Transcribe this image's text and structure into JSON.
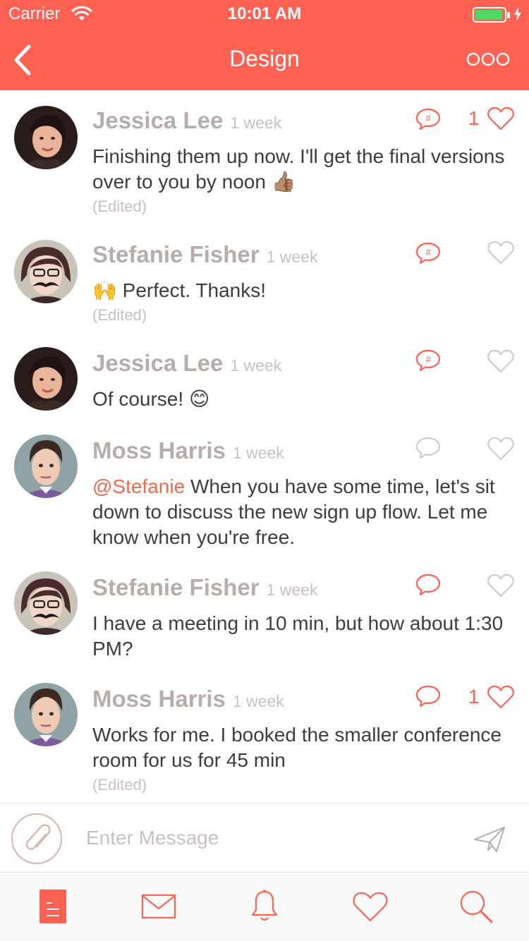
{
  "status_bar": {
    "carrier": "Carrier",
    "time": "10:01 AM"
  },
  "nav": {
    "title": "Design",
    "back_icon": "chevron-left-icon",
    "more_icon": "more-dots-icon"
  },
  "colors": {
    "accent": "#ff6152",
    "mention": "#ef6b4f",
    "name": "#b7aeab",
    "meta": "#c9c1be",
    "text": "#3d3d3d"
  },
  "messages": [
    {
      "author": "Jessica Lee",
      "time": "1 week",
      "text": "Finishing them up now. I'll get the final versions over to you by noon 👍🏽",
      "edited": "(Edited)",
      "like_count": "1",
      "liked": true,
      "comment_style": "tagged"
    },
    {
      "author": "Stefanie Fisher",
      "time": "1 week",
      "text": "🙌  Perfect. Thanks!",
      "edited": "(Edited)",
      "like_count": "",
      "liked": false,
      "comment_style": "tagged"
    },
    {
      "author": "Jessica Lee",
      "time": "1 week",
      "text": "Of course! 😊",
      "edited": "",
      "like_count": "",
      "liked": false,
      "comment_style": "tagged"
    },
    {
      "author": "Moss Harris",
      "time": "1 week",
      "mention": "@Stefanie",
      "text": " When you have some time, let's sit down to discuss the new sign up flow. Let me know when you're free.",
      "edited": "",
      "like_count": "",
      "liked": false,
      "comment_style": "empty"
    },
    {
      "author": "Stefanie Fisher",
      "time": "1 week",
      "text": "I have a meeting in 10 min, but how about 1:30 PM?",
      "edited": "",
      "like_count": "",
      "liked": false,
      "comment_style": "active"
    },
    {
      "author": "Moss Harris",
      "time": "1 week",
      "text": "Works for me. I booked the smaller conference room for us for 45 min",
      "edited": "(Edited)",
      "like_count": "1",
      "liked": true,
      "comment_style": "active"
    }
  ],
  "composer": {
    "placeholder": "Enter Message",
    "attach_icon": "paperclip-icon",
    "send_icon": "send-icon"
  },
  "tabs": [
    {
      "name": "feed",
      "icon": "document-icon",
      "active": true
    },
    {
      "name": "messages",
      "icon": "envelope-icon",
      "active": false
    },
    {
      "name": "notifications",
      "icon": "bell-icon",
      "active": false
    },
    {
      "name": "favorites",
      "icon": "heart-icon",
      "active": false
    },
    {
      "name": "search",
      "icon": "search-icon",
      "active": false
    }
  ]
}
